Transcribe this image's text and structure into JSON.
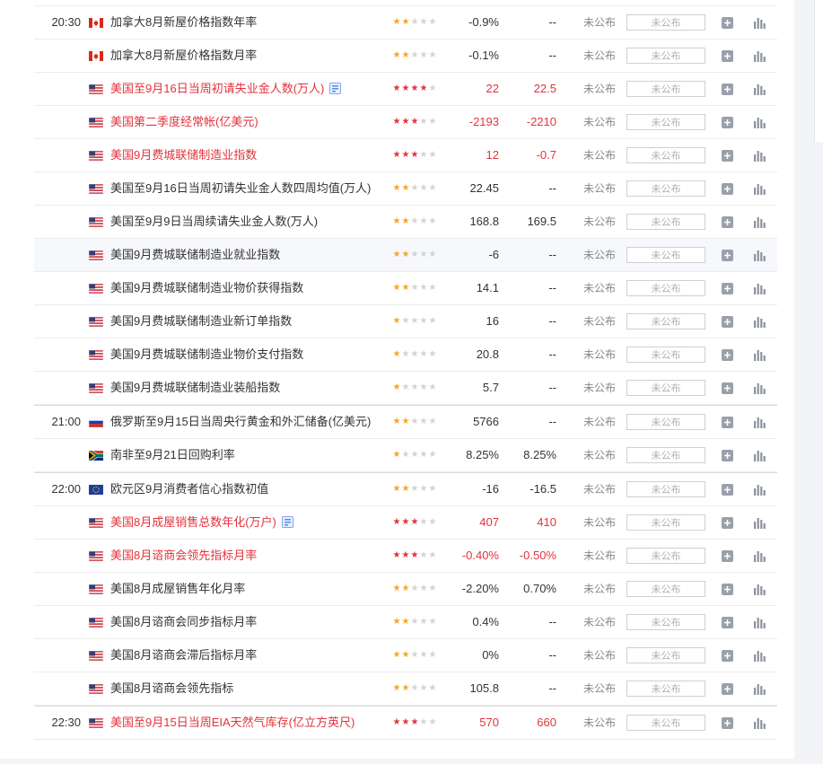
{
  "colors": {
    "red": "#e2333c",
    "star_yellow": "#f5a623",
    "star_grey": "#d3d3d3",
    "muted": "#888888"
  },
  "labels": {
    "status": "未公布",
    "actual_placeholder": "未公布"
  },
  "rows": [
    {
      "time": "20:30",
      "flag": "ca",
      "name": "加拿大8月新屋价格指数年率",
      "red": false,
      "badge": false,
      "stars": 2,
      "star_color": "yellow",
      "prev": "-0.9%",
      "forecast": "--",
      "val_red": false
    },
    {
      "time": "",
      "flag": "ca",
      "name": "加拿大8月新屋价格指数月率",
      "red": false,
      "badge": false,
      "stars": 2,
      "star_color": "yellow",
      "prev": "-0.1%",
      "forecast": "--",
      "val_red": false
    },
    {
      "time": "",
      "flag": "us",
      "name": "美国至9月16日当周初请失业金人数(万人)",
      "red": true,
      "badge": true,
      "stars": 4,
      "star_color": "red",
      "prev": "22",
      "forecast": "22.5",
      "val_red": true
    },
    {
      "time": "",
      "flag": "us",
      "name": "美国第二季度经常帐(亿美元)",
      "red": true,
      "badge": false,
      "stars": 3,
      "star_color": "red",
      "prev": "-2193",
      "forecast": "-2210",
      "val_red": true
    },
    {
      "time": "",
      "flag": "us",
      "name": "美国9月费城联储制造业指数",
      "red": true,
      "badge": false,
      "stars": 3,
      "star_color": "red",
      "prev": "12",
      "forecast": "-0.7",
      "val_red": true
    },
    {
      "time": "",
      "flag": "us",
      "name": "美国至9月16日当周初请失业金人数四周均值(万人)",
      "red": false,
      "badge": false,
      "stars": 2,
      "star_color": "yellow",
      "prev": "22.45",
      "forecast": "--",
      "val_red": false
    },
    {
      "time": "",
      "flag": "us",
      "name": "美国至9月9日当周续请失业金人数(万人)",
      "red": false,
      "badge": false,
      "stars": 2,
      "star_color": "yellow",
      "prev": "168.8",
      "forecast": "169.5",
      "val_red": false
    },
    {
      "time": "",
      "flag": "us",
      "name": "美国9月费城联储制造业就业指数",
      "red": false,
      "badge": false,
      "stars": 2,
      "star_color": "yellow",
      "prev": "-6",
      "forecast": "--",
      "val_red": false,
      "hl": true
    },
    {
      "time": "",
      "flag": "us",
      "name": "美国9月费城联储制造业物价获得指数",
      "red": false,
      "badge": false,
      "stars": 2,
      "star_color": "yellow",
      "prev": "14.1",
      "forecast": "--",
      "val_red": false
    },
    {
      "time": "",
      "flag": "us",
      "name": "美国9月费城联储制造业新订单指数",
      "red": false,
      "badge": false,
      "stars": 1,
      "star_color": "yellow",
      "prev": "16",
      "forecast": "--",
      "val_red": false
    },
    {
      "time": "",
      "flag": "us",
      "name": "美国9月费城联储制造业物价支付指数",
      "red": false,
      "badge": false,
      "stars": 1,
      "star_color": "yellow",
      "prev": "20.8",
      "forecast": "--",
      "val_red": false
    },
    {
      "time": "",
      "flag": "us",
      "name": "美国9月费城联储制造业装船指数",
      "red": false,
      "badge": false,
      "stars": 1,
      "star_color": "yellow",
      "prev": "5.7",
      "forecast": "--",
      "val_red": false
    },
    {
      "time": "21:00",
      "flag": "ru",
      "name": "俄罗斯至9月15日当周央行黄金和外汇储备(亿美元)",
      "red": false,
      "badge": false,
      "stars": 2,
      "star_color": "yellow",
      "prev": "5766",
      "forecast": "--",
      "val_red": false,
      "group": true
    },
    {
      "time": "",
      "flag": "za",
      "name": "南非至9月21日回购利率",
      "red": false,
      "badge": false,
      "stars": 1,
      "star_color": "yellow",
      "prev": "8.25%",
      "forecast": "8.25%",
      "val_red": false
    },
    {
      "time": "22:00",
      "flag": "eu",
      "name": "欧元区9月消费者信心指数初值",
      "red": false,
      "badge": false,
      "stars": 2,
      "star_color": "yellow",
      "prev": "-16",
      "forecast": "-16.5",
      "val_red": false,
      "group": true
    },
    {
      "time": "",
      "flag": "us",
      "name": "美国8月成屋销售总数年化(万户)",
      "red": true,
      "badge": true,
      "stars": 3,
      "star_color": "red",
      "prev": "407",
      "forecast": "410",
      "val_red": true
    },
    {
      "time": "",
      "flag": "us",
      "name": "美国8月谘商会领先指标月率",
      "red": true,
      "badge": false,
      "stars": 3,
      "star_color": "red",
      "prev": "-0.40%",
      "forecast": "-0.50%",
      "val_red": true
    },
    {
      "time": "",
      "flag": "us",
      "name": "美国8月成屋销售年化月率",
      "red": false,
      "badge": false,
      "stars": 2,
      "star_color": "yellow",
      "prev": "-2.20%",
      "forecast": "0.70%",
      "val_red": false
    },
    {
      "time": "",
      "flag": "us",
      "name": "美国8月谘商会同步指标月率",
      "red": false,
      "badge": false,
      "stars": 2,
      "star_color": "yellow",
      "prev": "0.4%",
      "forecast": "--",
      "val_red": false
    },
    {
      "time": "",
      "flag": "us",
      "name": "美国8月谘商会滞后指标月率",
      "red": false,
      "badge": false,
      "stars": 2,
      "star_color": "yellow",
      "prev": "0%",
      "forecast": "--",
      "val_red": false
    },
    {
      "time": "",
      "flag": "us",
      "name": "美国8月谘商会领先指标",
      "red": false,
      "badge": false,
      "stars": 2,
      "star_color": "yellow",
      "prev": "105.8",
      "forecast": "--",
      "val_red": false
    },
    {
      "time": "22:30",
      "flag": "us",
      "name": "美国至9月15日当周EIA天然气库存(亿立方英尺)",
      "red": true,
      "badge": false,
      "stars": 3,
      "star_color": "red",
      "prev": "570",
      "forecast": "660",
      "val_red": true,
      "group": true
    }
  ]
}
